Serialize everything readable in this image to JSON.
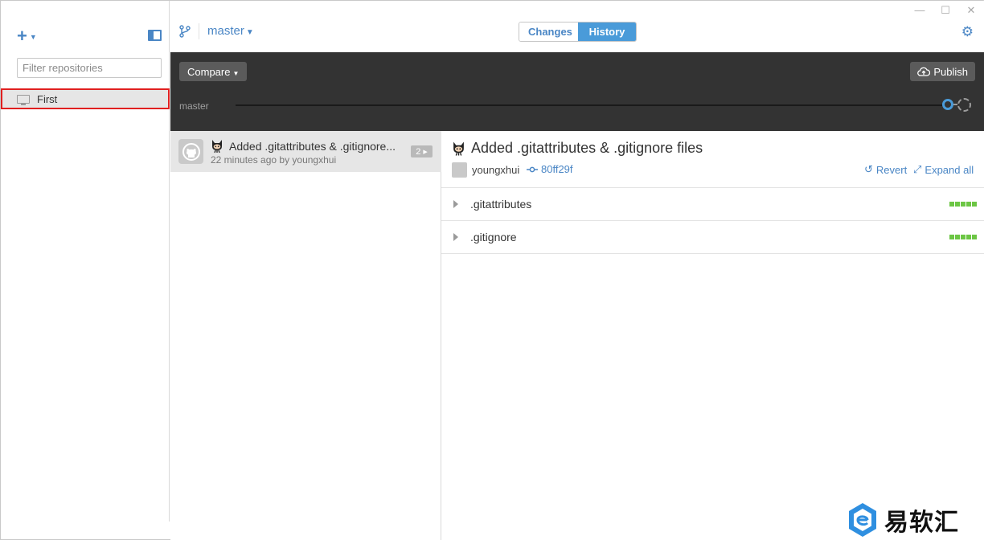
{
  "sidebar": {
    "filter_placeholder": "Filter repositories",
    "repos": [
      {
        "label": "First"
      }
    ]
  },
  "topbar": {
    "branch": "master",
    "tabs": {
      "changes": "Changes",
      "history": "History"
    },
    "active_tab": "History"
  },
  "toolbar": {
    "compare_label": "Compare",
    "publish_label": "Publish",
    "branch_track_label": "master"
  },
  "commits": [
    {
      "title": "Added .gitattributes & .gitignore...",
      "meta": "22 minutes ago by youngxhui",
      "file_count": "2"
    }
  ],
  "detail": {
    "title": "Added .gitattributes & .gitignore files",
    "author": "youngxhui",
    "sha": "80ff29f",
    "revert_label": "Revert",
    "expand_label": "Expand all",
    "files": [
      {
        "name": ".gitattributes"
      },
      {
        "name": ".gitignore"
      }
    ]
  },
  "watermark": {
    "text": "易软汇"
  },
  "colors": {
    "accent": "#4a86c5",
    "tab_active": "#4a9bd9",
    "dark_band": "#333333",
    "additions": "#6cc644",
    "highlight_border": "#e02020"
  }
}
